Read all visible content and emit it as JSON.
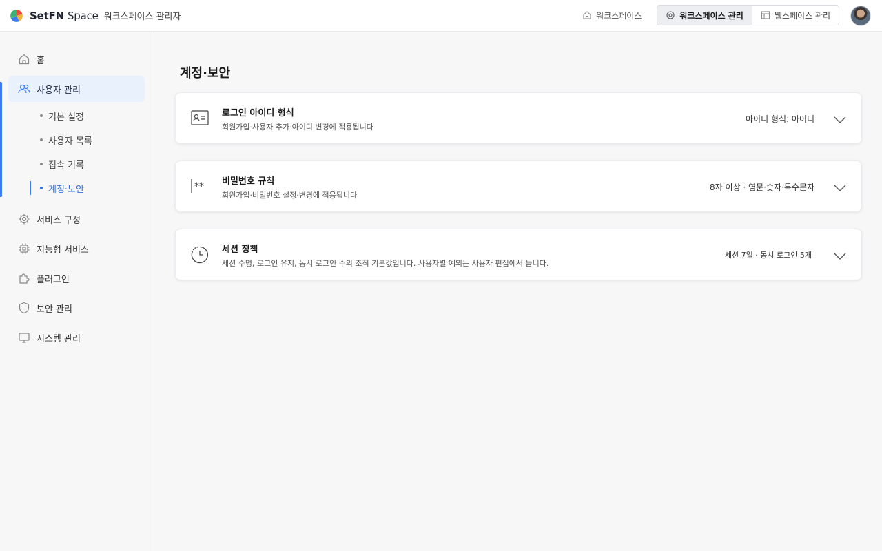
{
  "header": {
    "brand_bold": "SetFN",
    "brand_light": "Space",
    "subtitle": "워크스페이스 관리자",
    "nav_workspace": "워크스페이스",
    "nav_workspace_admin": "워크스페이스 관리",
    "nav_webspace_admin": "웹스페이스 관리"
  },
  "sidebar": {
    "items": [
      {
        "label": "홈",
        "icon": "home-icon"
      },
      {
        "label": "사용자 관리",
        "icon": "users-icon"
      },
      {
        "label": "서비스 구성",
        "icon": "gear-icon"
      },
      {
        "label": "지능형 서비스",
        "icon": "chip-icon"
      },
      {
        "label": "플러그인",
        "icon": "puzzle-icon"
      },
      {
        "label": "보안 관리",
        "icon": "shield-icon"
      },
      {
        "label": "시스템 관리",
        "icon": "monitor-icon"
      }
    ],
    "sub_items": [
      {
        "label": "기본 설정"
      },
      {
        "label": "사용자 목록"
      },
      {
        "label": "접속 기록"
      },
      {
        "label": "계정·보안"
      }
    ]
  },
  "main": {
    "title": "계정·보안",
    "cards": [
      {
        "title": "로그인 아이디 형식",
        "desc": "회원가입·사용자 추가·아이디 변경에 적용됩니다",
        "value": "아이디 형식: 아이디",
        "icon": "id-card-icon"
      },
      {
        "title": "비밀번호 규칙",
        "desc": "회원가입·비밀번호 설정·변경에 적용됩니다",
        "value": "8자 이상 · 영문·숫자·특수문자",
        "icon": "password-icon"
      },
      {
        "title": "세션 정책",
        "desc": "세션 수명, 로그인 유지, 동시 로그인 수의 조직 기본값입니다. 사용자별 예외는 사용자 편집에서 둡니다.",
        "value": "세션 7일 · 동시 로그인 5개",
        "icon": "clock-icon"
      }
    ]
  },
  "colors": {
    "accent": "#3d7cf0",
    "active_bg": "#e9f1fd"
  }
}
